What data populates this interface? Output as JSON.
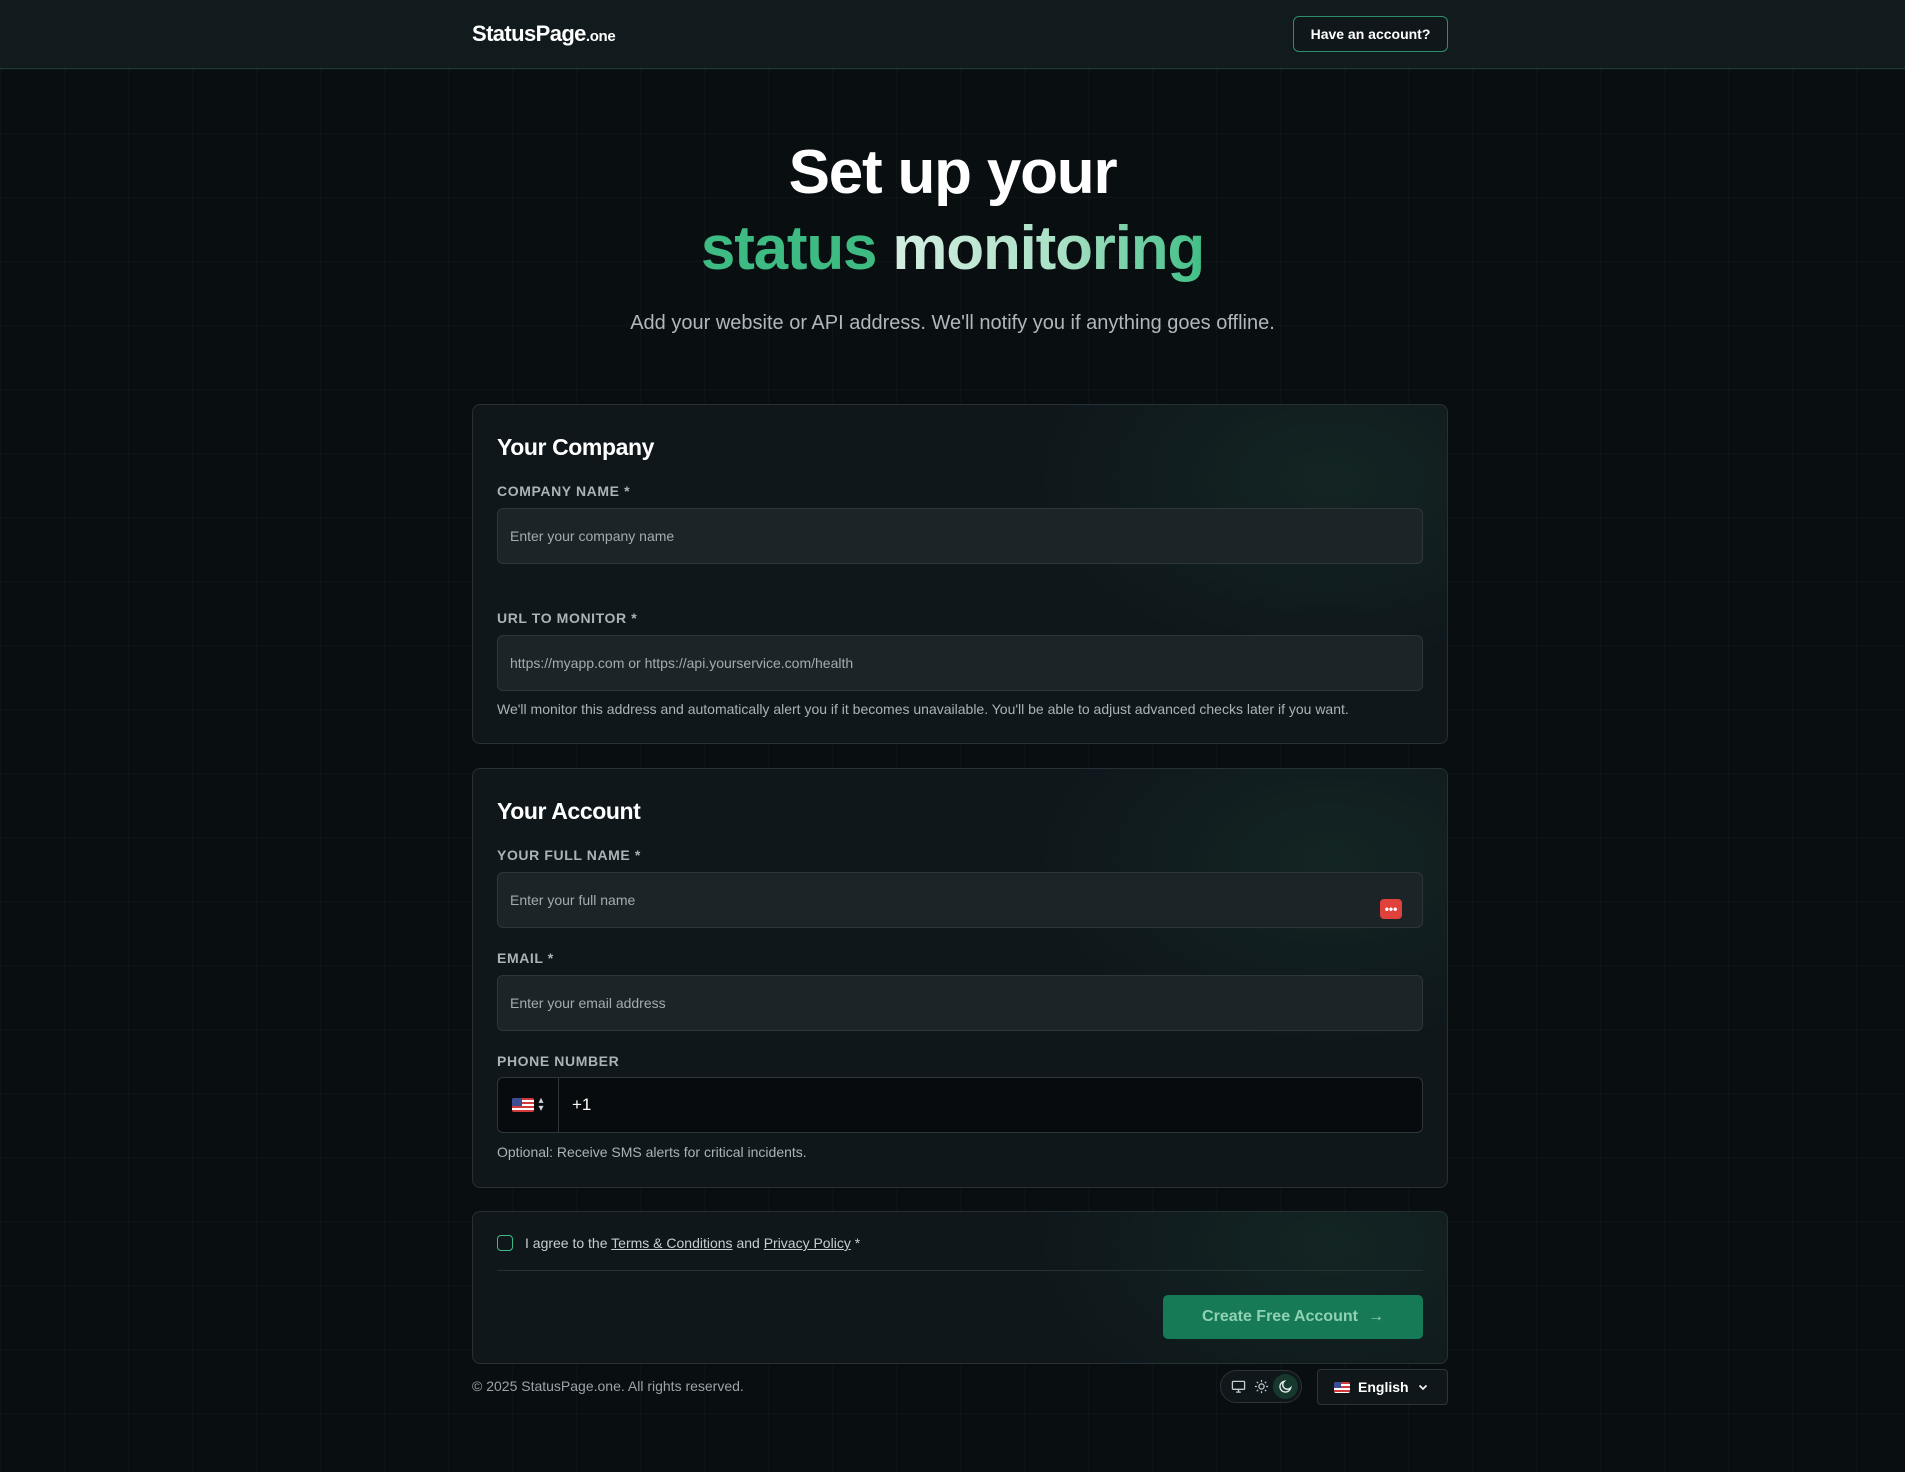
{
  "header": {
    "logo_main": "StatusPage",
    "logo_tld": ".one",
    "login_label": "Have an account?"
  },
  "hero": {
    "title_line1": "Set up your",
    "title_word_a": "status",
    "title_word_b": "monitoring",
    "subtitle": "Add your website or API address. We'll notify you if anything goes offline."
  },
  "company_card": {
    "title": "Your Company",
    "company_name_label": "COMPANY NAME *",
    "company_name_placeholder": "Enter your company name",
    "company_name_value": "",
    "url_label": "URL TO MONITOR *",
    "url_placeholder": "https://myapp.com or https://api.yourservice.com/health",
    "url_value": "",
    "url_hint": "We'll monitor this address and automatically alert you if it becomes unavailable. You'll be able to adjust advanced checks later if you want."
  },
  "account_card": {
    "title": "Your Account",
    "full_name_label": "YOUR FULL NAME *",
    "full_name_placeholder": "Enter your full name",
    "full_name_value": "",
    "password_manager_badge": "•••",
    "email_label": "EMAIL *",
    "email_placeholder": "Enter your email address",
    "email_value": "",
    "phone_label": "PHONE NUMBER",
    "phone_country": "us-flag-icon",
    "phone_value": "+1",
    "phone_hint": "Optional: Receive SMS alerts for critical incidents."
  },
  "submit_card": {
    "agree_prefix": "I agree to the",
    "terms_link": "Terms & Conditions",
    "agree_and": "and",
    "privacy_link": "Privacy Policy",
    "agree_required": "*",
    "agree_checked": false,
    "submit_label": "Create Free Account",
    "submit_arrow": "→"
  },
  "footer": {
    "copyright": "© 2025 StatusPage.one. All rights reserved.",
    "theme_options": [
      "monitor-icon",
      "sun-icon",
      "moon-icon"
    ],
    "theme_selected": "moon-icon",
    "language_label": "English",
    "language_flag": "us-flag-icon"
  },
  "colors": {
    "background": "#090e11",
    "accent": "#3dbb82",
    "button_bg": "#177a57",
    "card_bg": "#0f171b",
    "password_badge": "#e0413b"
  }
}
